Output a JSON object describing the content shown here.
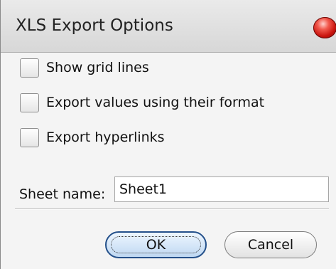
{
  "dialog": {
    "title": "XLS Export Options",
    "options": [
      {
        "label": "Show grid lines",
        "checked": false
      },
      {
        "label": "Export values using their format",
        "checked": false
      },
      {
        "label": "Export hyperlinks",
        "checked": false
      }
    ],
    "sheet_name_label": "Sheet name:",
    "sheet_name_value": "Sheet1",
    "ok_label": "OK",
    "cancel_label": "Cancel"
  },
  "icons": {
    "close": "close-icon"
  },
  "colors": {
    "titlebar": "#d7d7d7",
    "close_button": "#c9140e",
    "default_button_border": "#24508a"
  }
}
